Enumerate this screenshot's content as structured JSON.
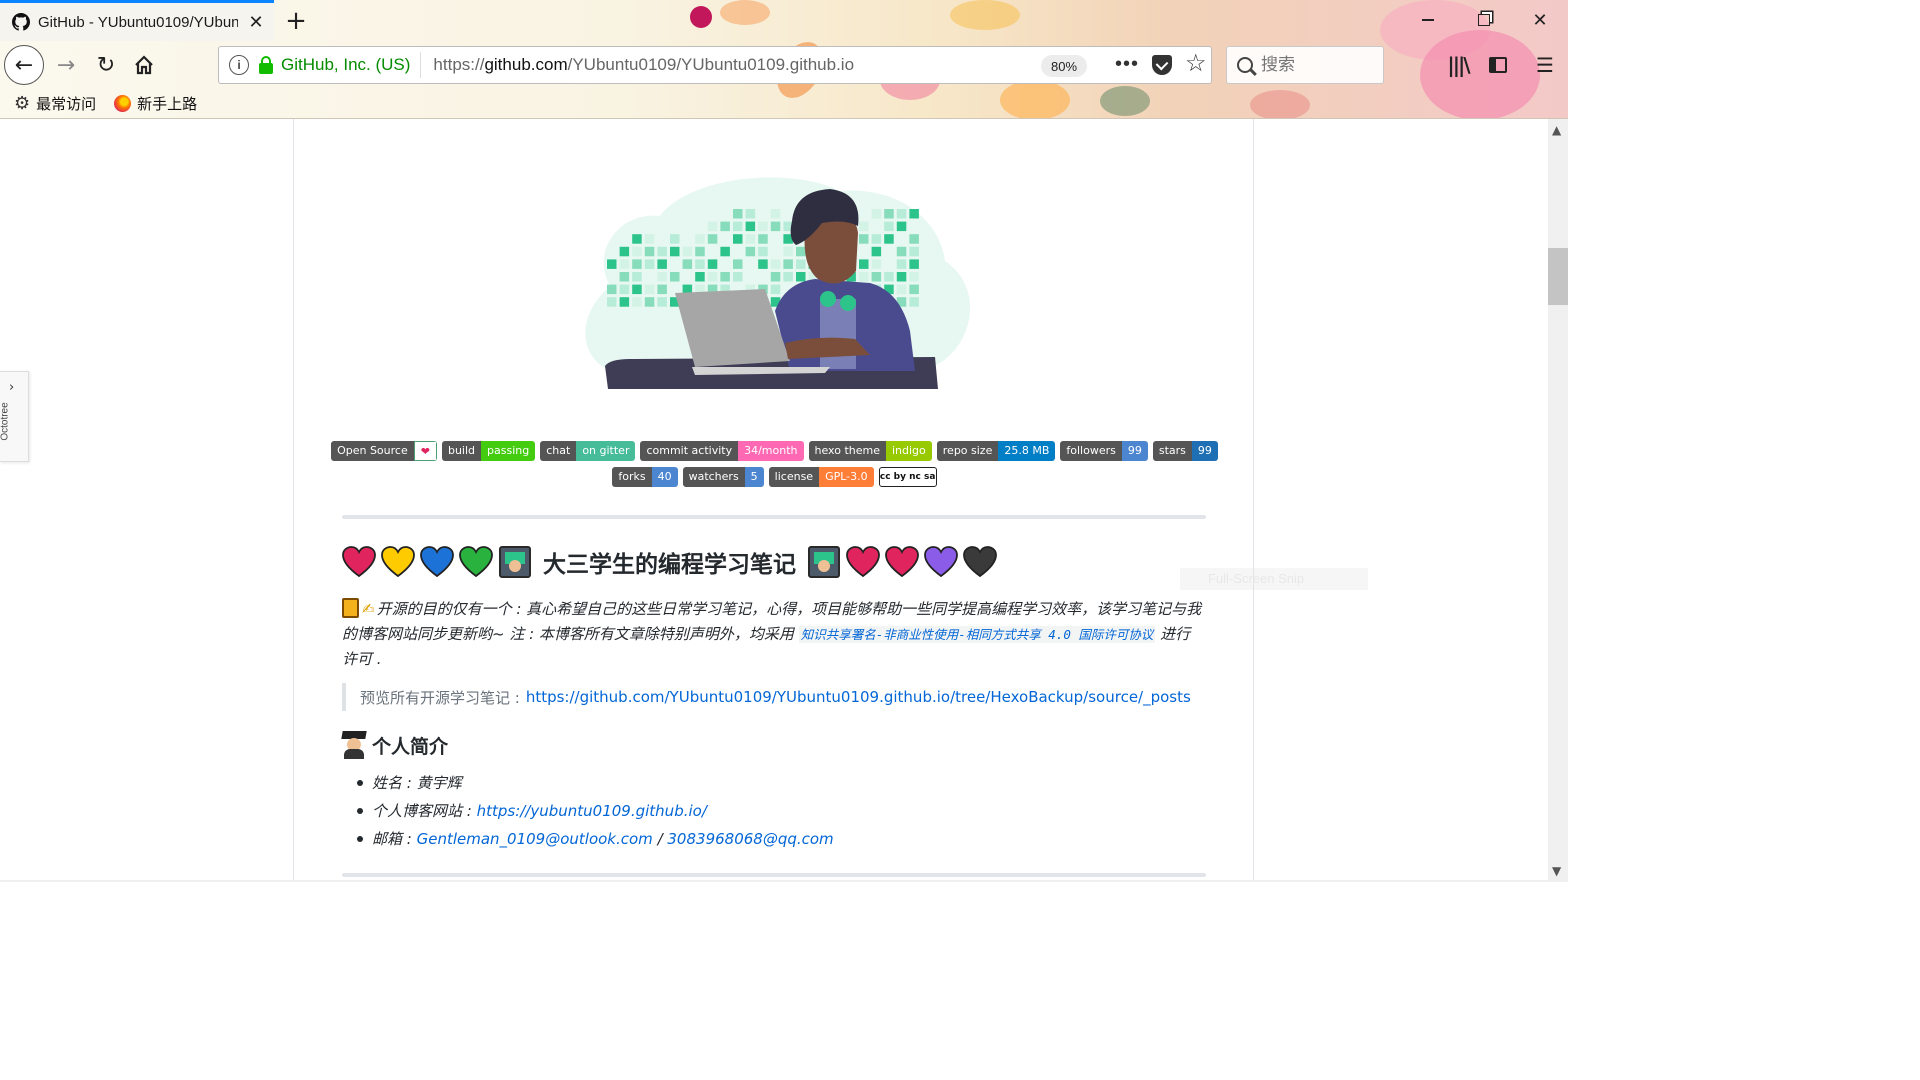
{
  "browser": {
    "tab_title": "GitHub - YUbuntu0109/YUbuntu0109.github.io",
    "cert_label": "GitHub, Inc. (US)",
    "url_prefix": "https://",
    "url_domain": "github.com",
    "url_path": "/YUbuntu0109/YUbuntu0109.github.io",
    "zoom": "80%",
    "search_placeholder": "搜索",
    "bookmarks": [
      "最常访问",
      "新手上路"
    ]
  },
  "octotree_label": "Octotree",
  "ghost_text": "Full-Screen Snip",
  "badges_row1": [
    {
      "left": "Open Source",
      "right": "❤",
      "color": "#4c9f70"
    },
    {
      "left": "build",
      "right": "passing",
      "color": "#4c1"
    },
    {
      "left": "chat",
      "right": "on gitter",
      "color": "#46bc99"
    },
    {
      "left": "commit activity",
      "right": "34/month",
      "color": "#ff69b4"
    },
    {
      "left": "hexo theme",
      "right": "indigo",
      "color": "#97ca00"
    },
    {
      "left": "repo size",
      "right": "25.8 MB",
      "color": "#007ec6"
    },
    {
      "left": "followers",
      "right": "99",
      "color": "#4c86d0"
    },
    {
      "left": "stars",
      "right": "99",
      "color": "#1e6fb4"
    }
  ],
  "badges_row2": [
    {
      "left": "forks",
      "right": "40",
      "color": "#4c86d0"
    },
    {
      "left": "watchers",
      "right": "5",
      "color": "#4c86d0"
    },
    {
      "left": "license",
      "right": "GPL-3.0",
      "color": "#fe7d37"
    }
  ],
  "cc_badge": "cc by nc sa",
  "heading": "大三学生的编程学习笔记",
  "hearts_left": [
    "#e0245e",
    "#fdcb00",
    "#1d72d8",
    "#2ab23e"
  ],
  "hearts_right": [
    "#e0245e",
    "#e0245e",
    "#8a5ce8",
    "#3a3a3a"
  ],
  "intro": {
    "text1": "开源的目的仅有一个 : 真心希望自己的这些日常学习笔记，心得，项目能够帮助一些同学提高编程学习效率，该学习笔记与我的博客网站同步更新哟~ 注 : 本博客所有文章除特别声明外，均采用 ",
    "license_link": "知识共享署名-非商业性使用-相同方式共享 4.0 国际许可协议",
    "text2": " 进行许可 ."
  },
  "quote": {
    "label": "预览所有开源学习笔记 :",
    "link": "https://github.com/YUbuntu0109/YUbuntu0109.github.io/tree/HexoBackup/source/_posts"
  },
  "profile": {
    "title": "个人简介",
    "name_label": "姓名 : ",
    "name_value": "黄宇辉",
    "blog_label": "个人博客网站 : ",
    "blog_link": "https://yubuntu0109.github.io/",
    "email_label": "邮箱 : ",
    "email1": "Gentleman_0109@outlook.com",
    "email_sep": " / ",
    "email2": "3083968068@qq.com"
  }
}
